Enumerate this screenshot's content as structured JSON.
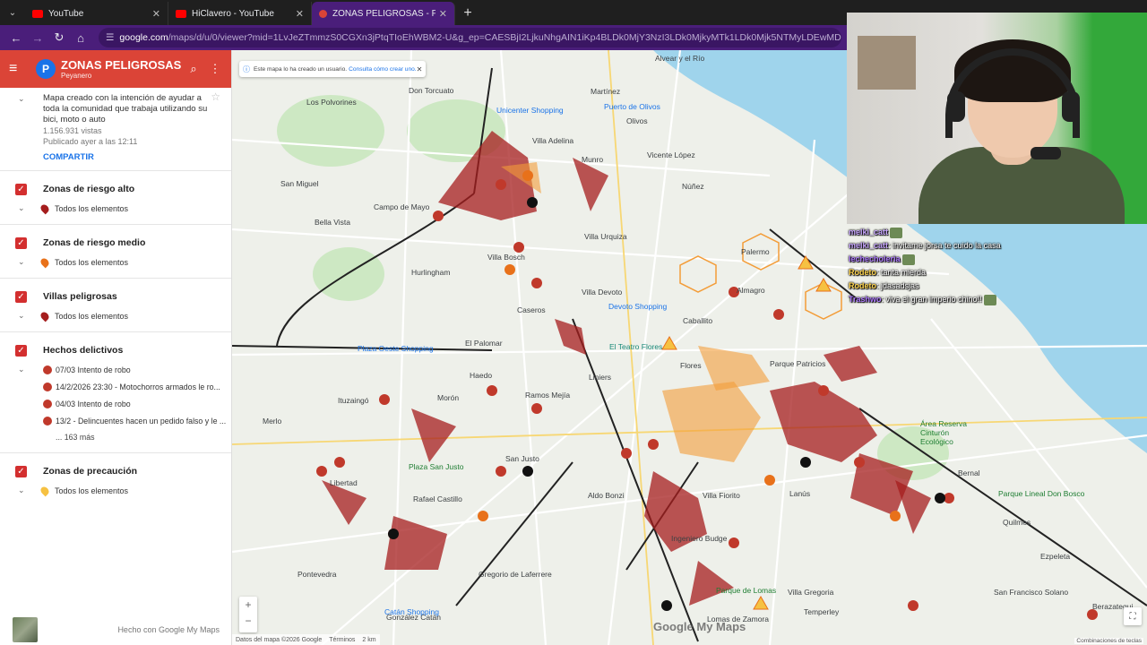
{
  "browser": {
    "tabs": [
      {
        "label": "YouTube",
        "icon": "youtube-icon",
        "active": false
      },
      {
        "label": "HiClavero - YouTube",
        "icon": "youtube-icon",
        "active": false
      },
      {
        "label": "ZONAS PELIGROSAS - PEYANE",
        "icon": "maps-pin-icon",
        "active": true
      }
    ],
    "url_domain": "google.com",
    "url_rest": "/maps/d/u/0/viewer?mid=1LvJeZTmmzS0CGXn3jPtqTIoEhWBM2-U&g_ep=CAESBjI2LjkuNhgAIN1iKp4BLDk0MjY3NzI3LDk0MjkyMTk1LDk0Mjk5NTMyLDEwMDc5NjQ5MDcwMDA3OTY..."
  },
  "sidebar": {
    "title": "ZONAS PELIGROSAS -...",
    "owner": "Peyanero",
    "avatar_letter": "P",
    "description": "Mapa creado con la intención de ayudar a toda la comunidad que trabaja utilizando su bici, moto o auto",
    "views": "1.156.931 vistas",
    "published": "Publicado ayer a las 12:11",
    "share_label": "COMPARTIR",
    "layers": [
      {
        "title": "Zonas de riesgo alto",
        "sub": "Todos los elementos",
        "pin_color": "#a51d1d"
      },
      {
        "title": "Zonas de riesgo medio",
        "sub": "Todos los elementos",
        "pin_color": "#e8711a"
      },
      {
        "title": "Villas peligrosas",
        "sub": "Todos los elementos",
        "pin_color": "#a51d1d"
      }
    ],
    "incidents_layer": {
      "title": "Hechos delictivos",
      "items": [
        "07/03 Intento de robo",
        "14/2/2026 23:30 - Motochorros armados le ro...",
        "04/03 Intento de robo",
        "13/2 - Delincuentes hacen un pedido falso y le ..."
      ],
      "more": "... 163 más"
    },
    "caution_layer": {
      "title": "Zonas de precaución",
      "sub": "Todos los elementos",
      "pin_color": "#f6c142"
    },
    "made_with": "Hecho con Google My Maps"
  },
  "map": {
    "banner_text": "Este mapa lo ha creado un usuario.",
    "banner_link": "Consulta cómo crear uno.",
    "places": [
      {
        "name": "Alvear y el Río"
      },
      {
        "name": "Martínez"
      },
      {
        "name": "Olivos"
      },
      {
        "name": "Villa Adelina"
      },
      {
        "name": "Munro"
      },
      {
        "name": "Vicente López"
      },
      {
        "name": "Don Torcuato"
      },
      {
        "name": "Los Polvorines"
      },
      {
        "name": "San Miguel"
      },
      {
        "name": "Campo de Mayo"
      },
      {
        "name": "Bella Vista"
      },
      {
        "name": "Villa Bosch"
      },
      {
        "name": "Hurlingham"
      },
      {
        "name": "Villa Urquiza"
      },
      {
        "name": "Villa Devoto"
      },
      {
        "name": "Caseros"
      },
      {
        "name": "El Palomar"
      },
      {
        "name": "Palermo"
      },
      {
        "name": "Almagro"
      },
      {
        "name": "Caballito"
      },
      {
        "name": "Flores"
      },
      {
        "name": "Parque Patricios"
      },
      {
        "name": "Liniers"
      },
      {
        "name": "Haedo"
      },
      {
        "name": "Ituzaingó"
      },
      {
        "name": "Morón"
      },
      {
        "name": "Ramos Mejía"
      },
      {
        "name": "Merlo"
      },
      {
        "name": "San Justo"
      },
      {
        "name": "Libertad"
      },
      {
        "name": "Rafael Castillo"
      },
      {
        "name": "Aldo Bonzi"
      },
      {
        "name": "Villa Fiorito"
      },
      {
        "name": "Lanús"
      },
      {
        "name": "Bernal"
      },
      {
        "name": "Quilmes"
      },
      {
        "name": "Ingeniero Budge"
      },
      {
        "name": "Gregorio de Laferrere"
      },
      {
        "name": "Pontevedra"
      },
      {
        "name": "González Catán"
      },
      {
        "name": "Temperley"
      },
      {
        "name": "Ezpeleta"
      },
      {
        "name": "Berazategui"
      },
      {
        "name": "San Francisco Solano"
      },
      {
        "name": "Área Reserva Cinturón Ecológico"
      },
      {
        "name": "Puerto de Olivos"
      },
      {
        "name": "Núñez"
      },
      {
        "name": "El Teatro Flores"
      },
      {
        "name": "Devoto Shopping"
      },
      {
        "name": "Plaza Oeste Shopping"
      },
      {
        "name": "Catán Shopping"
      },
      {
        "name": "Plaza San Justo"
      },
      {
        "name": "Unicenter Shopping"
      },
      {
        "name": "Parque Lineal Don Bosco"
      },
      {
        "name": "Parque de Lomas"
      },
      {
        "name": "Lomas de Zamora"
      },
      {
        "name": "Villa Gregoria"
      }
    ],
    "zoom_in": "+",
    "zoom_out": "−",
    "attribution": "Datos del mapa ©2026 Google",
    "terms": "Términos",
    "scale": "2 km",
    "logo": "Google My Maps",
    "shortcuts": "Combinaciones de teclas"
  },
  "chat": [
    {
      "user": "melki_catt",
      "msg": "",
      "color": "#c8a6ff"
    },
    {
      "user": "melki_catt",
      "msg": ": invitame jorsa te cuido la casa",
      "color": "#c8a6ff"
    },
    {
      "user": "lechecholeria",
      "msg": "",
      "color": "#b07cff"
    },
    {
      "user": "Rodeto",
      "msg": ": tanta mierda",
      "color": "#ffd54f"
    },
    {
      "user": "Rodeto",
      "msg": ": jdasadsjas",
      "color": "#ffd54f"
    },
    {
      "user": "Trashwo",
      "msg": ": viva el gran imperio chino!!",
      "color": "#b07cff"
    }
  ]
}
